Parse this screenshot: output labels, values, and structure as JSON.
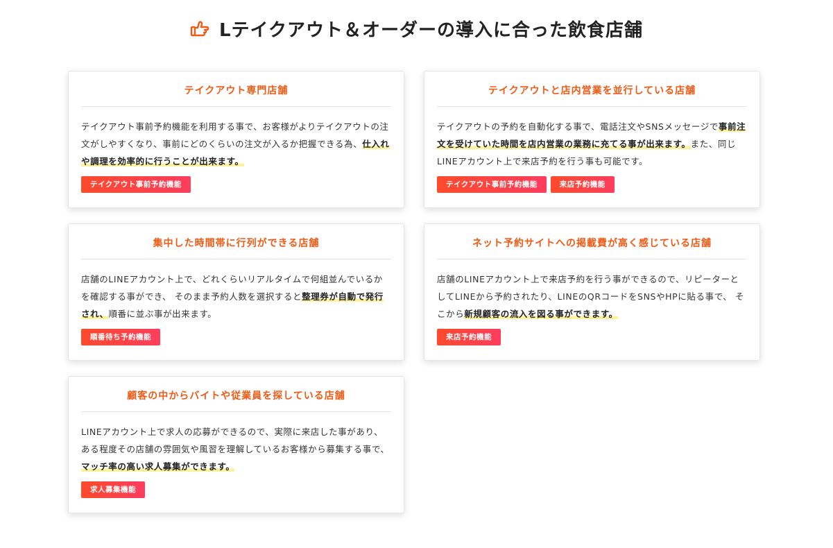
{
  "header": {
    "title": "Lテイクアウト＆オーダーの導入に合った飲食店舗",
    "icon": "thumb-point-right-icon",
    "icon_color": "#f05a14"
  },
  "colors": {
    "accent": "#f05a14",
    "tag_gradient_start": "#ff4a2c",
    "tag_gradient_end": "#ff3d5e",
    "highlight": "#fff29a"
  },
  "cards": [
    {
      "title": "テイクアウト専門店舗",
      "text_before": "テイクアウト事前予約機能を利用する事で、お客様がよりテイクアウトの注文がしやすくなり、事前にどのくらいの注文が入るか把握できる為、",
      "highlight": "仕入れや調理を効率的に行うことが出来ます。",
      "text_after": "",
      "tags": [
        "テイクアウト事前予約機能"
      ]
    },
    {
      "title": "テイクアウトと店内営業を並行している店舗",
      "text_before": "テイクアウトの予約を自動化する事で、電話注文やSNSメッセージで",
      "highlight": "事前注文を受けていた時間を店内営業の業務に充てる事が出来ます。",
      "text_after": "また、同じLINEアカウント上で来店予約を行う事も可能です。",
      "tags": [
        "テイクアウト事前予約機能",
        "来店予約機能"
      ]
    },
    {
      "title": "集中した時間帯に行列ができる店舗",
      "text_before": "店舗のLINEアカウント上で、どれくらいリアルタイムで何組並んでいるかを確認する事ができ、 そのまま予約人数を選択すると",
      "highlight": "整理券が自動で発行され、",
      "text_after": "順番に並ぶ事が出来ます。",
      "tags": [
        "順番待ち予約機能"
      ]
    },
    {
      "title": "ネット予約サイトへの掲載費が高く感じている店舗",
      "text_before": "店舗のLINEアカウント上で来店予約を行う事ができるので、リピーターとしてLINEから予約されたり、LINEのQRコードをSNSやHPに貼る事で、 そこから",
      "highlight": "新規顧客の流入を図る事ができます。",
      "text_after": "",
      "tags": [
        "来店予約機能"
      ]
    },
    {
      "title": "顧客の中からバイトや従業員を探している店舗",
      "text_before": "LINEアカウント上で求人の応募ができるので、実際に来店した事があり、ある程度その店舗の雰囲気や風習を理解しているお客様から募集する事で、",
      "highlight": "マッチ率の高い求人募集ができます。",
      "text_after": "",
      "tags": [
        "求人募集機能"
      ]
    }
  ]
}
